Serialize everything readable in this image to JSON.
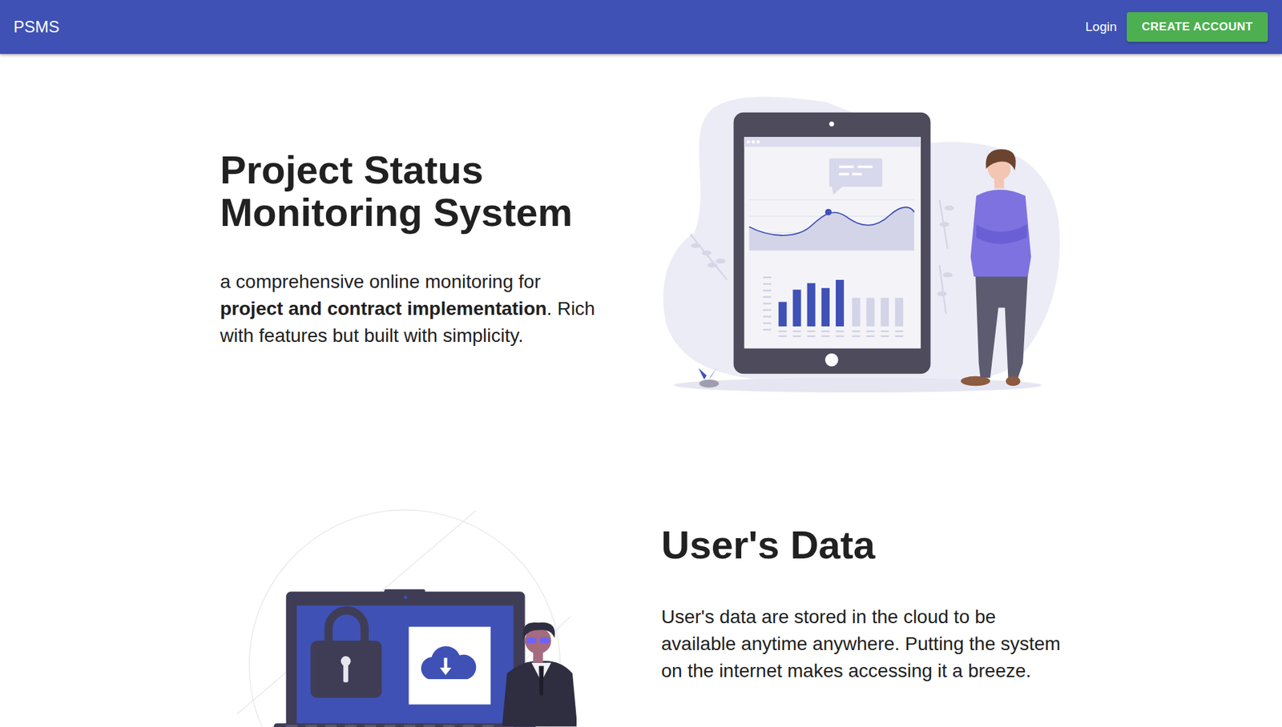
{
  "header": {
    "brand": "PSMS",
    "login": "Login",
    "create_account": "CREATE ACCOUNT"
  },
  "sections": [
    {
      "kind": "dashboard",
      "title": "Project Status Monitoring System",
      "text": [
        {
          "text": "a comprehensive online monitoring for ",
          "bold": false
        },
        {
          "text": "project and contract implementation",
          "bold": true
        },
        {
          "text": ". Rich with features but built with simplicity.",
          "bold": false
        }
      ]
    },
    {
      "kind": "security",
      "title": "User's Data",
      "text": [
        {
          "text": "User's data are stored in the cloud to be available anytime anywhere. Putting the system on the internet makes accessing it a breeze.",
          "bold": false
        }
      ]
    }
  ]
}
